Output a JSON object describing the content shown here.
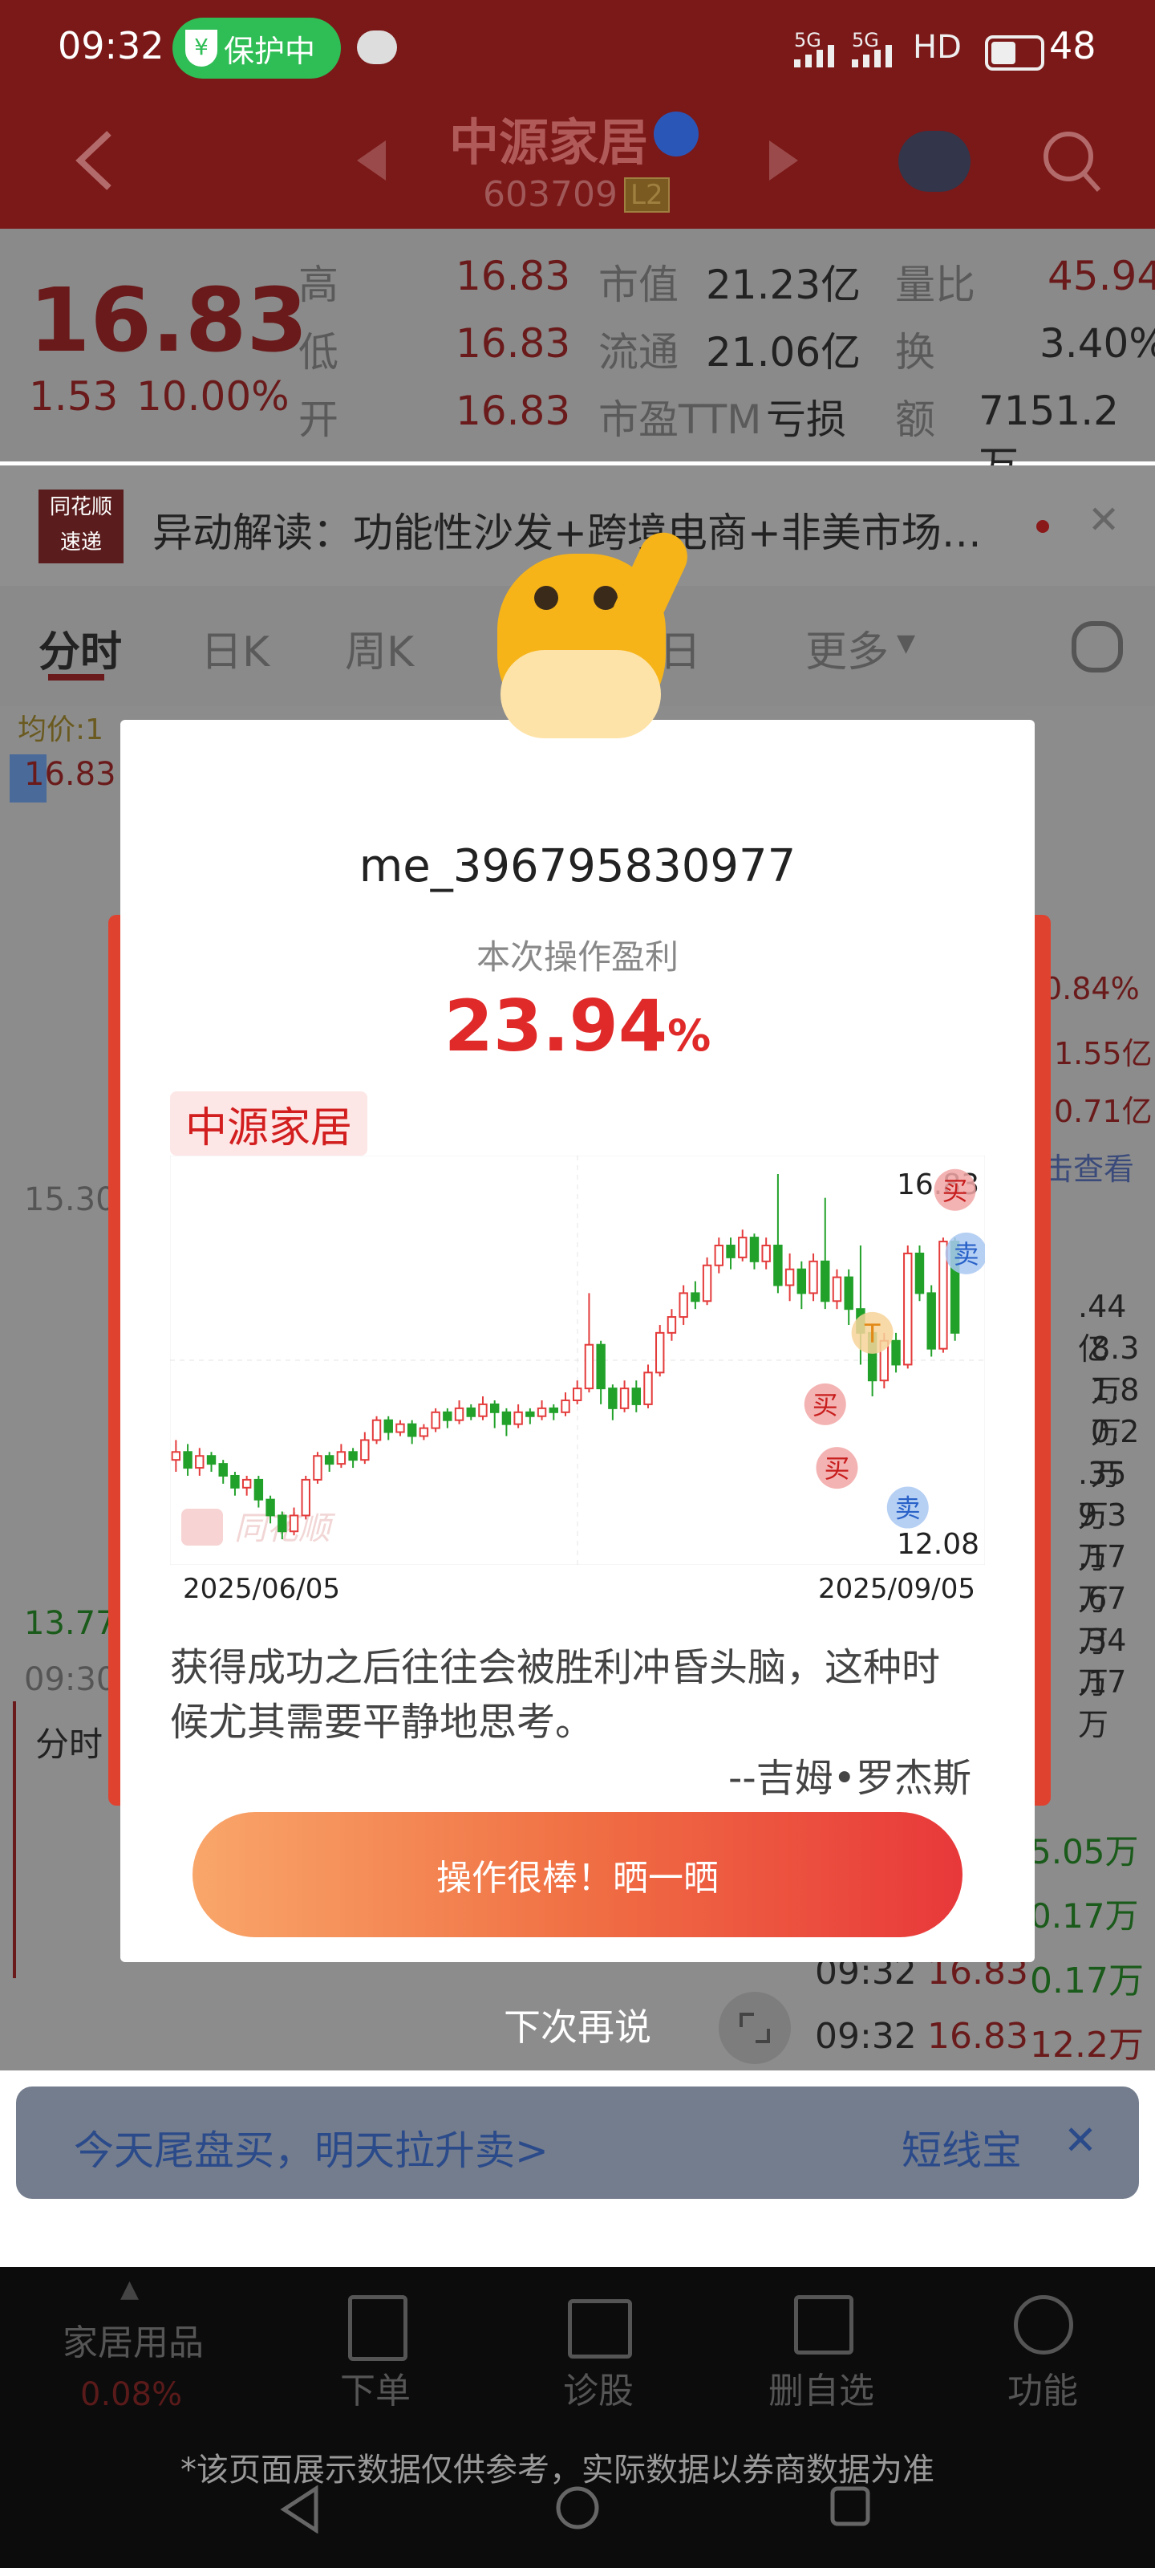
{
  "status_bar": {
    "time": "09:32",
    "protect_badge": "保护中",
    "battery": "48",
    "signal_1": "5G",
    "signal_2": "5G",
    "hd_label": "HD"
  },
  "header": {
    "title": "中源家居",
    "code": "603709",
    "level_badge": "L2"
  },
  "quote": {
    "price": "16.83",
    "change": "1.53",
    "change_pct": "10.00%",
    "rows": [
      {
        "l1": "高",
        "v1": "16.83",
        "l2": "市值",
        "v2": "21.23亿",
        "l3": "量比",
        "v3": "45.94"
      },
      {
        "l1": "低",
        "v1": "16.83",
        "l2": "流通",
        "v2": "21.06亿",
        "l3": "换",
        "v3": "3.40%"
      },
      {
        "l1": "开",
        "v1": "16.83",
        "l2": "市盈TTM",
        "v2": "亏损",
        "l3": "额",
        "v3": "7151.2万"
      }
    ]
  },
  "news": {
    "logo_top": "同花顺",
    "logo_bottom": "速递",
    "text": "异动解读：功能性沙发+跨境电商+非美市场…"
  },
  "tabs": {
    "items": [
      "分时",
      "日K",
      "周K",
      "五日",
      "更多"
    ]
  },
  "chart_area": {
    "avg_label": "均价:1",
    "price_top": "16.83",
    "price_mid": "15.30",
    "price_low": "13.77",
    "time_start": "09:30",
    "right_values": [
      "0.84%",
      "1.55亿",
      "0.71亿",
      "击查看",
      ".44亿",
      "8.3万",
      "1.8万",
      "0.2万",
      ".35万",
      "9.3万",
      ".17万",
      ".67万",
      ".34万",
      ".17万"
    ],
    "sub_tab": "分时",
    "trades": [
      {
        "time": "09:32",
        "price": "16.83",
        "vol": "0.17万"
      },
      {
        "time": "09:32",
        "price": "16.83",
        "vol": "12.2万"
      }
    ],
    "partial_vals": [
      "5.05万",
      "0.17万"
    ]
  },
  "banner": {
    "text": "今天尾盘买，明天拉升卖>",
    "right_text": "短线宝"
  },
  "bottom_nav": {
    "left_title": "家居用品",
    "left_pct": "0.08%",
    "items": [
      "下单",
      "诊股",
      "删自选",
      "功能"
    ],
    "disclaimer": "*该页面展示数据仅供参考，实际数据以券商数据为准"
  },
  "modal": {
    "username": "me_396795830977",
    "profit_label": "本次操作盈利",
    "profit_value": "23.94",
    "profit_unit": "%",
    "stock_tag": "中源家居",
    "date_start": "2025/06/05",
    "date_end": "2025/09/05",
    "price_high": "16.83",
    "price_low": "12.08",
    "watermark": "同花顺",
    "quote_text_1": "获得成功之后往往会被胜利冲昏头脑，这种时",
    "quote_text_2": "候尤其需要平静地思考。",
    "quote_author": "--吉姆•罗杰斯",
    "share_button": "操作很棒！晒一晒",
    "dismiss": "下次再说",
    "marker_buy": "买",
    "marker_sell": "卖",
    "marker_t": "T"
  },
  "chart_data": {
    "type": "candlestick",
    "x": [
      "2025/06/05",
      "2025/09/05"
    ],
    "ylim": [
      12.08,
      16.83
    ],
    "candles": [
      [
        13.2,
        13.3,
        13.45,
        13.05
      ],
      [
        13.3,
        13.1,
        13.4,
        13.0
      ],
      [
        13.1,
        13.25,
        13.35,
        13.0
      ],
      [
        13.25,
        13.15,
        13.3,
        13.05
      ],
      [
        13.15,
        13.0,
        13.2,
        12.9
      ],
      [
        13.0,
        12.85,
        13.05,
        12.75
      ],
      [
        12.85,
        12.95,
        13.0,
        12.75
      ],
      [
        12.95,
        12.7,
        13.0,
        12.6
      ],
      [
        12.7,
        12.5,
        12.75,
        12.4
      ],
      [
        12.5,
        12.3,
        12.55,
        12.2
      ],
      [
        12.3,
        12.5,
        12.6,
        12.25
      ],
      [
        12.5,
        12.95,
        13.0,
        12.45
      ],
      [
        12.95,
        13.25,
        13.3,
        12.9
      ],
      [
        13.25,
        13.15,
        13.3,
        13.05
      ],
      [
        13.15,
        13.3,
        13.4,
        13.1
      ],
      [
        13.3,
        13.2,
        13.35,
        13.1
      ],
      [
        13.2,
        13.45,
        13.55,
        13.15
      ],
      [
        13.45,
        13.7,
        13.75,
        13.4
      ],
      [
        13.7,
        13.55,
        13.75,
        13.45
      ],
      [
        13.55,
        13.65,
        13.7,
        13.5
      ],
      [
        13.65,
        13.5,
        13.7,
        13.4
      ],
      [
        13.5,
        13.6,
        13.65,
        13.45
      ],
      [
        13.6,
        13.8,
        13.85,
        13.55
      ],
      [
        13.8,
        13.7,
        13.85,
        13.6
      ],
      [
        13.7,
        13.85,
        13.95,
        13.65
      ],
      [
        13.85,
        13.75,
        13.9,
        13.7
      ],
      [
        13.75,
        13.9,
        14.0,
        13.7
      ],
      [
        13.9,
        13.8,
        13.95,
        13.6
      ],
      [
        13.8,
        13.65,
        13.85,
        13.5
      ],
      [
        13.65,
        13.8,
        13.9,
        13.6
      ],
      [
        13.8,
        13.75,
        13.85,
        13.65
      ],
      [
        13.75,
        13.85,
        13.95,
        13.7
      ],
      [
        13.85,
        13.8,
        13.9,
        13.7
      ],
      [
        13.8,
        13.95,
        14.05,
        13.75
      ],
      [
        13.95,
        14.1,
        14.2,
        13.9
      ],
      [
        14.1,
        14.65,
        15.3,
        14.05
      ],
      [
        14.65,
        14.1,
        14.7,
        13.9
      ],
      [
        14.1,
        13.85,
        14.15,
        13.7
      ],
      [
        13.85,
        14.1,
        14.2,
        13.8
      ],
      [
        14.1,
        13.9,
        14.2,
        13.8
      ],
      [
        13.9,
        14.3,
        14.4,
        13.85
      ],
      [
        14.3,
        14.8,
        14.9,
        14.25
      ],
      [
        14.8,
        15.0,
        15.1,
        14.7
      ],
      [
        15.0,
        15.3,
        15.4,
        14.9
      ],
      [
        15.3,
        15.2,
        15.45,
        15.1
      ],
      [
        15.2,
        15.65,
        15.75,
        15.15
      ],
      [
        15.65,
        15.9,
        16.0,
        15.55
      ],
      [
        15.9,
        15.75,
        16.0,
        15.6
      ],
      [
        15.75,
        16.0,
        16.1,
        15.7
      ],
      [
        16.0,
        15.7,
        16.05,
        15.6
      ],
      [
        15.7,
        15.9,
        16.0,
        15.6
      ],
      [
        15.9,
        15.4,
        16.8,
        15.3
      ],
      [
        15.4,
        15.6,
        15.8,
        15.2
      ],
      [
        15.6,
        15.3,
        15.7,
        15.1
      ],
      [
        15.3,
        15.7,
        15.8,
        15.2
      ],
      [
        15.7,
        15.2,
        16.5,
        15.1
      ],
      [
        15.2,
        15.5,
        15.6,
        15.1
      ],
      [
        15.5,
        15.1,
        15.6,
        14.9
      ],
      [
        15.1,
        14.8,
        15.9,
        14.4
      ],
      [
        14.8,
        14.2,
        14.9,
        14.0
      ],
      [
        14.2,
        14.7,
        14.8,
        14.1
      ],
      [
        14.7,
        14.4,
        14.8,
        14.3
      ],
      [
        14.4,
        15.8,
        15.9,
        14.35
      ],
      [
        15.8,
        15.3,
        15.9,
        15.2
      ],
      [
        15.3,
        14.6,
        15.4,
        14.5
      ],
      [
        14.6,
        15.95,
        16.0,
        14.55
      ],
      [
        15.95,
        14.8,
        16.0,
        14.7
      ]
    ]
  }
}
